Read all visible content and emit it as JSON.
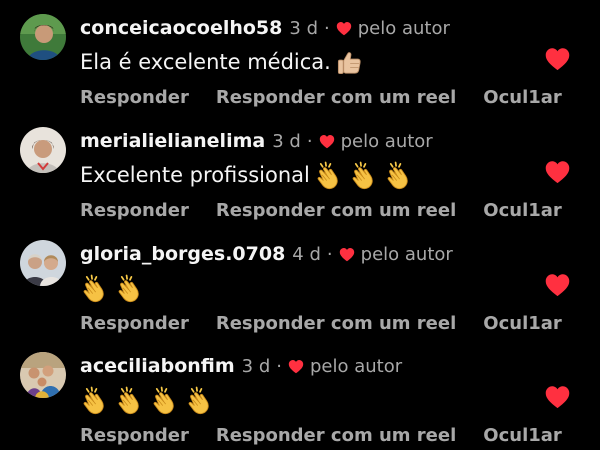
{
  "colors": {
    "background": "#000000",
    "text_primary": "#f5f5f5",
    "text_secondary": "#a8a8a8",
    "heart": "#ff3040"
  },
  "icons": {
    "like": "heart-icon",
    "author_like": "small-heart-icon",
    "clap": "clapping-hands-emoji",
    "thumbs": "thumbs-up-emoji"
  },
  "comments": [
    {
      "username": "conceicaocoelho58",
      "time": "3 d",
      "dot": "·",
      "author_label": "pelo autor",
      "text": "Ela é excelente médica.",
      "emoji_count": 1,
      "emoji_type": "thumbs-up",
      "reply_label": "Responder",
      "reel_label": "Responder com um reel",
      "hide_label": "Ocul1ar",
      "liked": true
    },
    {
      "username": "merialielianelima",
      "time": "3 d",
      "dot": "·",
      "author_label": "pelo autor",
      "text": "Excelente profissional",
      "emoji_count": 3,
      "emoji_type": "clap",
      "reply_label": "Responder",
      "reel_label": "Responder com um reel",
      "hide_label": "Ocul1ar",
      "liked": true
    },
    {
      "username": "gloria_borges.0708",
      "time": "4 d",
      "dot": "·",
      "author_label": "pelo autor",
      "text": "",
      "emoji_count": 2,
      "emoji_type": "clap",
      "reply_label": "Responder",
      "reel_label": "Responder com um reel",
      "hide_label": "Ocul1ar",
      "liked": true
    },
    {
      "username": "aceciliabonfim",
      "time": "3 d",
      "dot": "·",
      "author_label": "pelo autor",
      "text": "",
      "emoji_count": 4,
      "emoji_type": "clap",
      "reply_label": "Responder",
      "reel_label": "Responder com um reel",
      "hide_label": "Ocul1ar",
      "liked": true
    }
  ]
}
